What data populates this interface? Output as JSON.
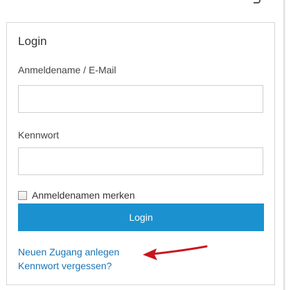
{
  "login_box": {
    "title": "Login",
    "username_label": "Anmeldename / E-Mail",
    "username_value": "",
    "password_label": "Kennwort",
    "password_value": "",
    "remember_label": "Anmeldenamen merken",
    "remember_checked": false,
    "login_button": "Login",
    "register_link": "Neuen Zugang anlegen",
    "forgot_link": "Kennwort vergessen?"
  },
  "colors": {
    "button_bg": "#1b92cf",
    "link": "#1a73b5",
    "annotation_arrow": "#c8161d"
  },
  "icons": {
    "annotation": "red-arrow-icon"
  }
}
